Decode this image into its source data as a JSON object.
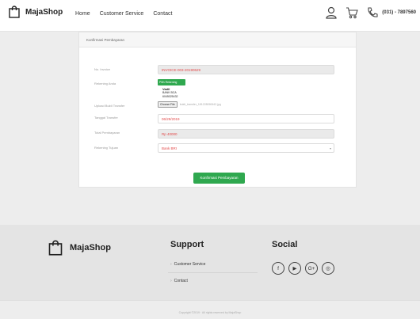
{
  "header": {
    "logo_text": "MajaShop",
    "nav": [
      "Home",
      "Customer Service",
      "Contact"
    ],
    "phone": "(031) - 7897560"
  },
  "card": {
    "title": "Konfirmasi Pembayaran",
    "labels": {
      "invoice": "No. Invoice",
      "rekening_anda": "Rekening Anda",
      "upload": "Upload Bukti Transfer",
      "tanggal": "Tanggal Transfer",
      "total": "Total Pembayaran",
      "tujuan": "Rekening Tujuan"
    },
    "invoice_value": "INVOICE-003-20190629",
    "pilih_rekening": "Pilih Rekening",
    "rekening": {
      "name": "Vadil",
      "bank": "BANK BCA",
      "number": "6045025432"
    },
    "upload": {
      "button": "Choose File",
      "filename": "bukti_transfer_181228050642.jpg"
    },
    "tanggal_value": "06/29/2019",
    "total_value": "Rp 40000",
    "tujuan_value": "Bank BRI",
    "submit": "Konfirmasi Pembayaran"
  },
  "footer": {
    "logo_text": "MajaShop",
    "support_title": "Support",
    "support_items": [
      "Customer Service",
      "Contact"
    ],
    "social_title": "Social",
    "social_icons": [
      "facebook-icon",
      "youtube-icon",
      "google-plus-icon",
      "instagram-icon"
    ],
    "copyright": "Copyright ©2019 · All rights reserved by MajaShop"
  }
}
